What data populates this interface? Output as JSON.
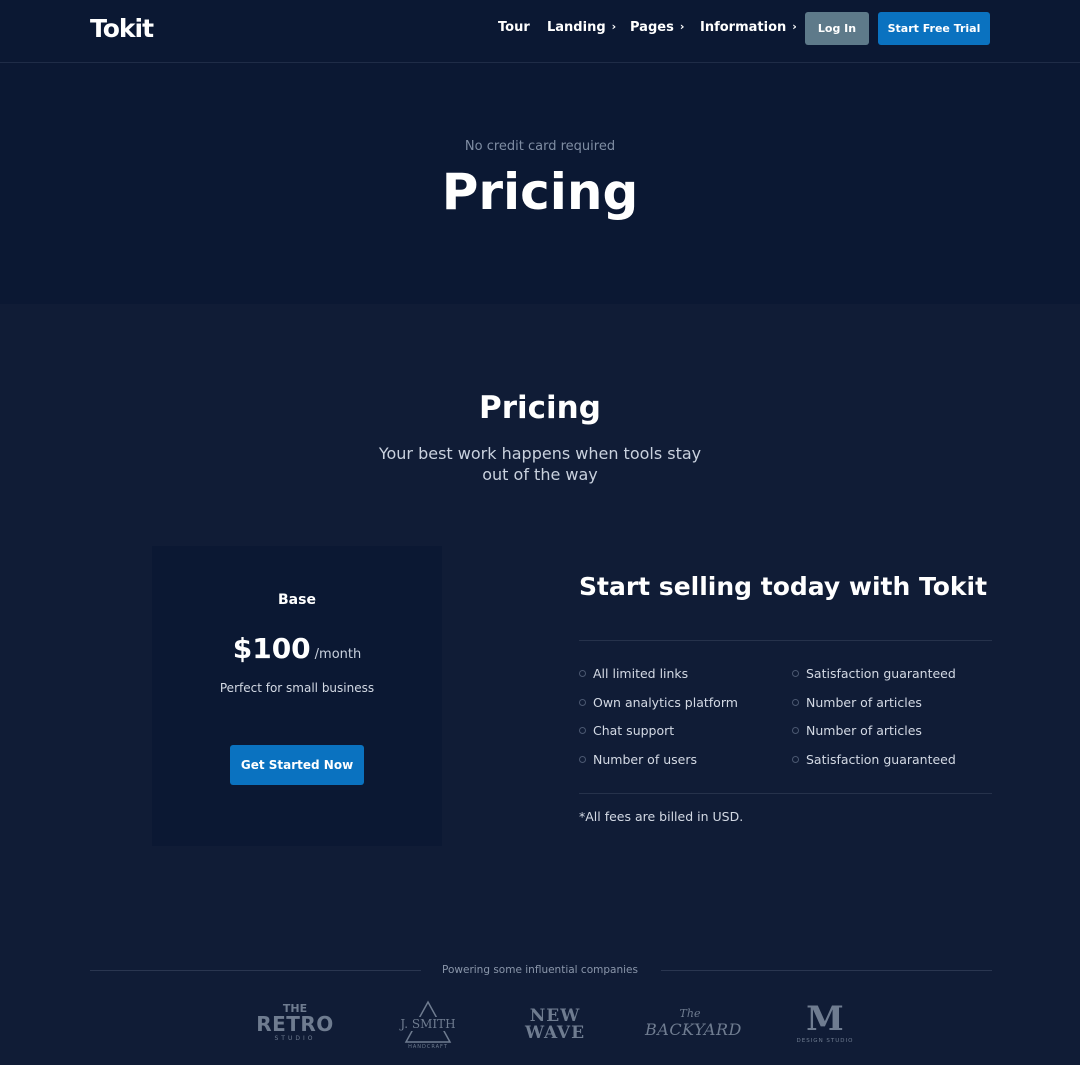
{
  "header": {
    "logo": "Tokit",
    "nav": [
      {
        "label": "Tour",
        "chevron": false
      },
      {
        "label": "Landing",
        "chevron": true
      },
      {
        "label": "Pages",
        "chevron": true
      },
      {
        "label": "Information",
        "chevron": true
      }
    ],
    "chevron_glyph": "›",
    "login_label": "Log In",
    "trial_label": "Start Free Trial"
  },
  "hero": {
    "kicker": "No credit card required",
    "title": "Pricing"
  },
  "section": {
    "title": "Pricing",
    "subtitle": "Your best work happens when tools stay out of the way"
  },
  "plan": {
    "name": "Base",
    "price": "$100",
    "period": "/month",
    "description": "Perfect for small business",
    "cta_label": "Get Started Now"
  },
  "features": {
    "title": "Start selling today with Tokit",
    "left": [
      "All limited links",
      "Own analytics platform",
      "Chat support",
      "Number of users"
    ],
    "right": [
      "Satisfaction guaranteed",
      "Number of articles",
      "Number of articles",
      "Satisfaction guaranteed"
    ],
    "note": "*All fees are billed in USD."
  },
  "companies": {
    "label": "Powering some influential companies",
    "logos": [
      {
        "icon": "retro-studio-logo",
        "line1": "THE",
        "line2": "RETRO",
        "line3": "STUDIO"
      },
      {
        "icon": "j-smith-logo",
        "line1": "J. SMITH",
        "line2": "HANDCRAFT"
      },
      {
        "icon": "new-wave-logo",
        "line1": "NEW",
        "line2": "WAVE"
      },
      {
        "icon": "backyard-logo",
        "line1": "The",
        "line2": "BACKYARD"
      },
      {
        "icon": "m-design-studio-logo",
        "line1": "M",
        "line2": "DESIGN STUDIO"
      }
    ]
  },
  "colors": {
    "page_bg": "#101c36",
    "header_bg": "#0b1833",
    "accent": "#0a72c0",
    "login_bg": "#5e7a8a"
  }
}
